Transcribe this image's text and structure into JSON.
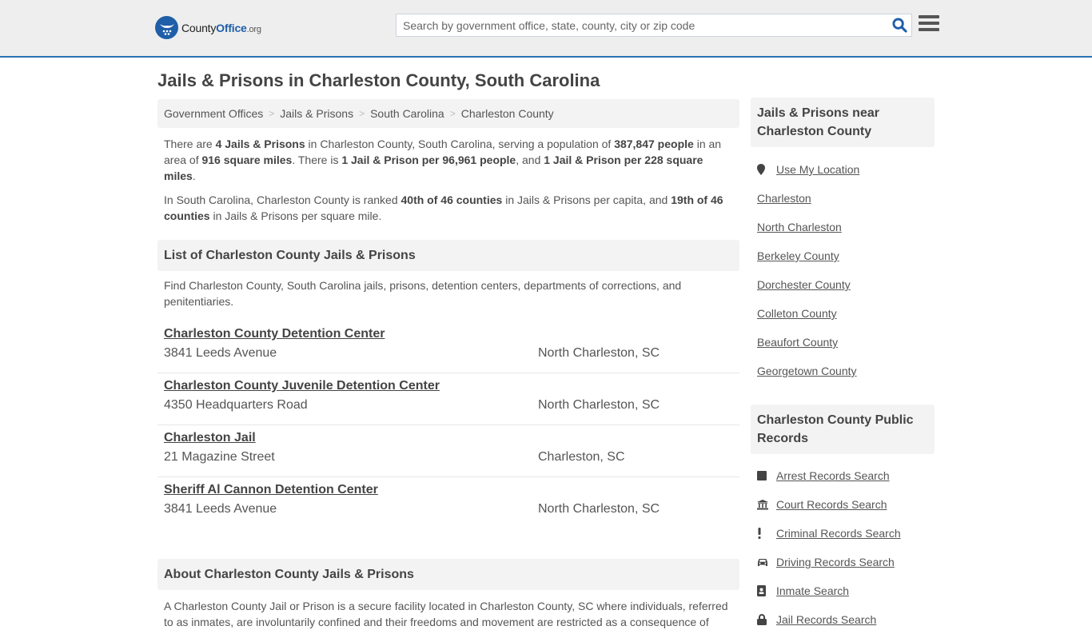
{
  "header": {
    "logo": {
      "county": "County",
      "office": "Office",
      "org": ".org"
    },
    "search_placeholder": "Search by government office, state, county, city or zip code"
  },
  "page_title": "Jails & Prisons in Charleston County, South Carolina",
  "breadcrumb": [
    "Government Offices",
    "Jails & Prisons",
    "South Carolina",
    "Charleston County"
  ],
  "intro": {
    "p1": {
      "t1": "There are ",
      "b1": "4 Jails & Prisons",
      "t2": " in Charleston County, South Carolina, serving a population of ",
      "b2": "387,847 people",
      "t3": " in an area of ",
      "b3": "916 square miles",
      "t4": ". There is ",
      "b4": "1 Jail & Prison per 96,961 people",
      "t5": ", and ",
      "b5": "1 Jail & Prison per 228 square miles",
      "t6": "."
    },
    "p2": {
      "t1": "In South Carolina, Charleston County is ranked ",
      "b1": "40th of 46 counties",
      "t2": " in Jails & Prisons per capita, and ",
      "b2": "19th of 46 counties",
      "t3": " in Jails & Prisons per square mile."
    }
  },
  "list_section": {
    "title": "List of Charleston County Jails & Prisons",
    "description": "Find Charleston County, South Carolina jails, prisons, detention centers, departments of corrections, and penitentiaries.",
    "facilities": [
      {
        "name": "Charleston County Detention Center",
        "address": "3841 Leeds Avenue",
        "city": "North Charleston, SC"
      },
      {
        "name": "Charleston County Juvenile Detention Center",
        "address": "4350 Headquarters Road",
        "city": "North Charleston, SC"
      },
      {
        "name": "Charleston Jail",
        "address": "21 Magazine Street",
        "city": "Charleston, SC"
      },
      {
        "name": "Sheriff Al Cannon Detention Center",
        "address": "3841 Leeds Avenue",
        "city": "North Charleston, SC"
      }
    ]
  },
  "about_section": {
    "title": "About Charleston County Jails & Prisons",
    "text": "A Charleston County Jail or Prison is a secure facility located in Charleston County, SC where individuals, referred to as inmates, are involuntarily confined and their freedoms and movement are restricted as a consequence of"
  },
  "sidebar": {
    "nearby": {
      "title": "Jails & Prisons near Charleston County",
      "use_location": "Use My Location",
      "items": [
        "Charleston",
        "North Charleston",
        "Berkeley County",
        "Dorchester County",
        "Colleton County",
        "Beaufort County",
        "Georgetown County"
      ]
    },
    "records": {
      "title": "Charleston County Public Records",
      "items": [
        {
          "label": "Arrest Records Search",
          "icon": "arrest-icon"
        },
        {
          "label": "Court Records Search",
          "icon": "courthouse-icon"
        },
        {
          "label": "Criminal Records Search",
          "icon": "exclamation-icon"
        },
        {
          "label": "Driving Records Search",
          "icon": "car-icon"
        },
        {
          "label": "Inmate Search",
          "icon": "id-badge-icon"
        },
        {
          "label": "Jail Records Search",
          "icon": "lock-icon"
        }
      ]
    }
  },
  "colors": {
    "brand": "#1f5ea8",
    "accent_border": "#2b72b4"
  }
}
